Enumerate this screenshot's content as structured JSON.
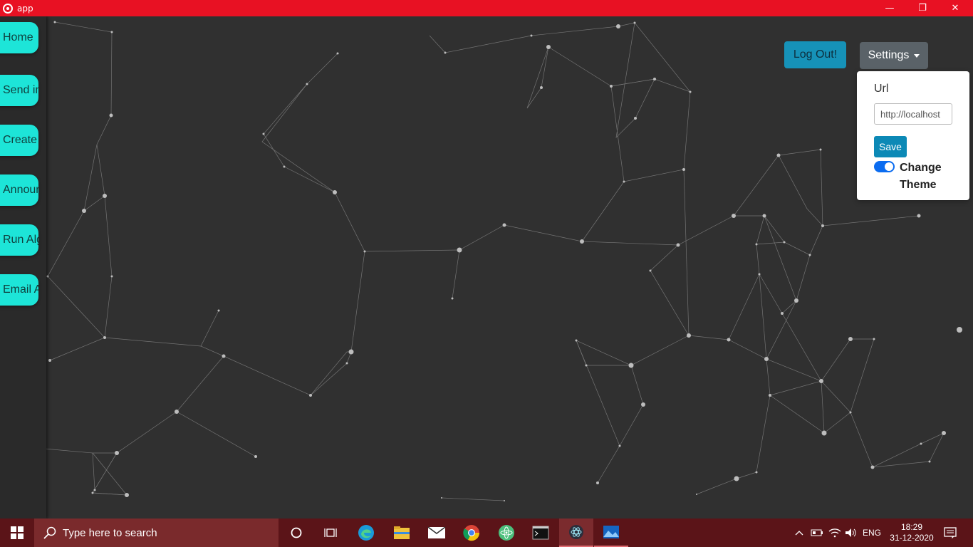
{
  "window": {
    "title": "app",
    "minimize_glyph": "—",
    "restore_glyph": "❐",
    "close_glyph": "✕"
  },
  "sidebar": {
    "items": [
      {
        "label": "Home"
      },
      {
        "label": "Send info"
      },
      {
        "label": "Create"
      },
      {
        "label": "Announce"
      },
      {
        "label": "Run Algo"
      },
      {
        "label": "Email All"
      }
    ]
  },
  "header": {
    "logout_label": "Log Out!",
    "settings_label": "Settings"
  },
  "settings_menu": {
    "url_label": "Url",
    "url_value": "http://localhost",
    "save_label": "Save",
    "theme_toggle_label": "Change Theme",
    "theme_toggle_on": true
  },
  "taskbar": {
    "search_placeholder": "Type here to search",
    "language": "ENG",
    "time": "18:29",
    "date": "31-12-2020",
    "apps": [
      "cortana-icon",
      "task-view-icon",
      "edge-icon",
      "file-explorer-icon",
      "mail-icon",
      "chrome-icon",
      "atom-icon",
      "terminal-icon",
      "electron-app-icon",
      "photos-icon"
    ]
  },
  "colors": {
    "titlebar": "#e81123",
    "background": "#303030",
    "nav_button": "#1de5d8",
    "logout_button": "#1692b8",
    "settings_button": "#5a6268",
    "taskbar": "#5b1418"
  }
}
